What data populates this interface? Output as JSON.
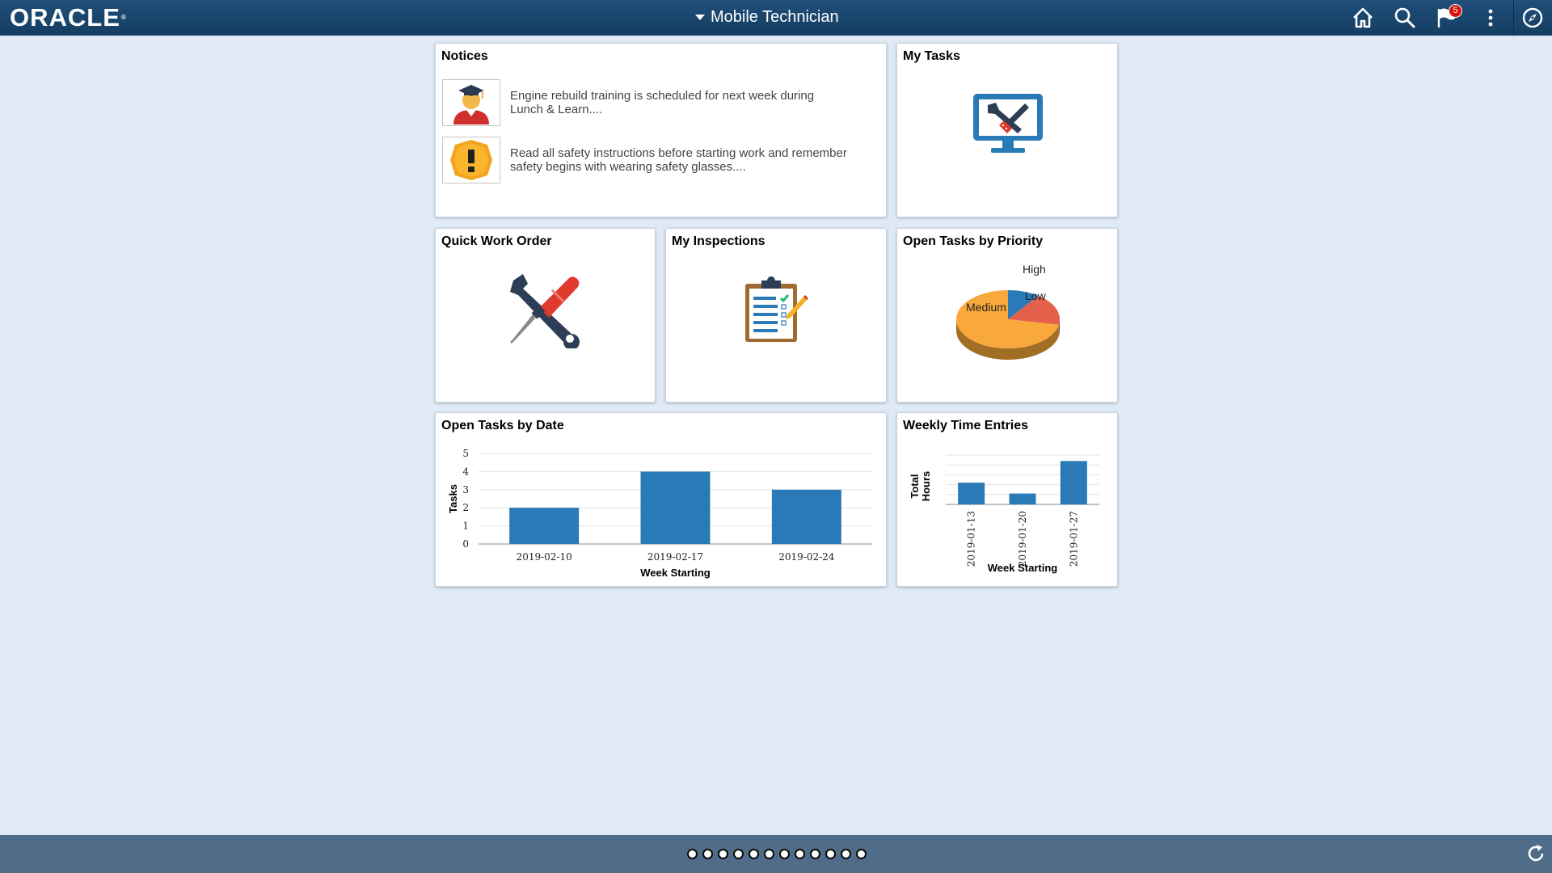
{
  "header": {
    "logo_text": "ORACLE",
    "logo_mark": "®",
    "title": "Mobile Technician",
    "notification_count": "5",
    "icons": [
      "home-icon",
      "search-icon",
      "notification-flag-icon",
      "actions-menu-icon",
      "navbar-compass-icon"
    ]
  },
  "tiles": {
    "notices": {
      "title": "Notices",
      "items": [
        {
          "icon": "graduate-icon",
          "text": "Engine rebuild training is scheduled for next week during Lunch & Learn...."
        },
        {
          "icon": "safety-warning-icon",
          "text": "Read all safety instructions before starting work and remember safety begins with wearing safety glasses...."
        }
      ]
    },
    "my_tasks": {
      "title": "My Tasks",
      "icon": "monitor-tools-icon"
    },
    "quick_work_order": {
      "title": "Quick Work Order",
      "icon": "wrench-screwdriver-icon"
    },
    "my_inspections": {
      "title": "My Inspections",
      "icon": "clipboard-checklist-icon"
    },
    "open_tasks_priority": {
      "title": "Open Tasks by Priority"
    },
    "open_tasks_date": {
      "title": "Open Tasks by Date"
    },
    "weekly_time": {
      "title": "Weekly Time Entries"
    }
  },
  "chart_data": [
    {
      "type": "pie",
      "title": "Open Tasks by Priority",
      "categories": [
        "Medium",
        "High",
        "Low"
      ],
      "values": [
        72,
        10,
        18
      ],
      "colors": [
        "#f9a93b",
        "#2a7ab8",
        "#e5604a"
      ]
    },
    {
      "type": "bar",
      "title": "Open Tasks by Date",
      "categories": [
        "2019-02-10",
        "2019-02-17",
        "2019-02-24"
      ],
      "values": [
        2,
        4,
        3
      ],
      "xlabel": "Week Starting",
      "ylabel": "Tasks",
      "ylim": [
        0,
        5
      ],
      "yticks": [
        "0",
        "1",
        "2",
        "3",
        "4",
        "5"
      ],
      "color": "#2a7ab8",
      "grid": true
    },
    {
      "type": "bar",
      "title": "Weekly Time Entries",
      "categories": [
        "2019-01-13",
        "2019-01-20",
        "2019-01-27"
      ],
      "values": [
        22,
        11,
        44
      ],
      "xlabel": "Week Starting",
      "ylabel": "Total Hours",
      "ylim": [
        0,
        50
      ],
      "color": "#2a7ab8",
      "grid": true
    }
  ],
  "footer": {
    "page_count": 12,
    "icons": [
      "refresh-icon"
    ]
  }
}
